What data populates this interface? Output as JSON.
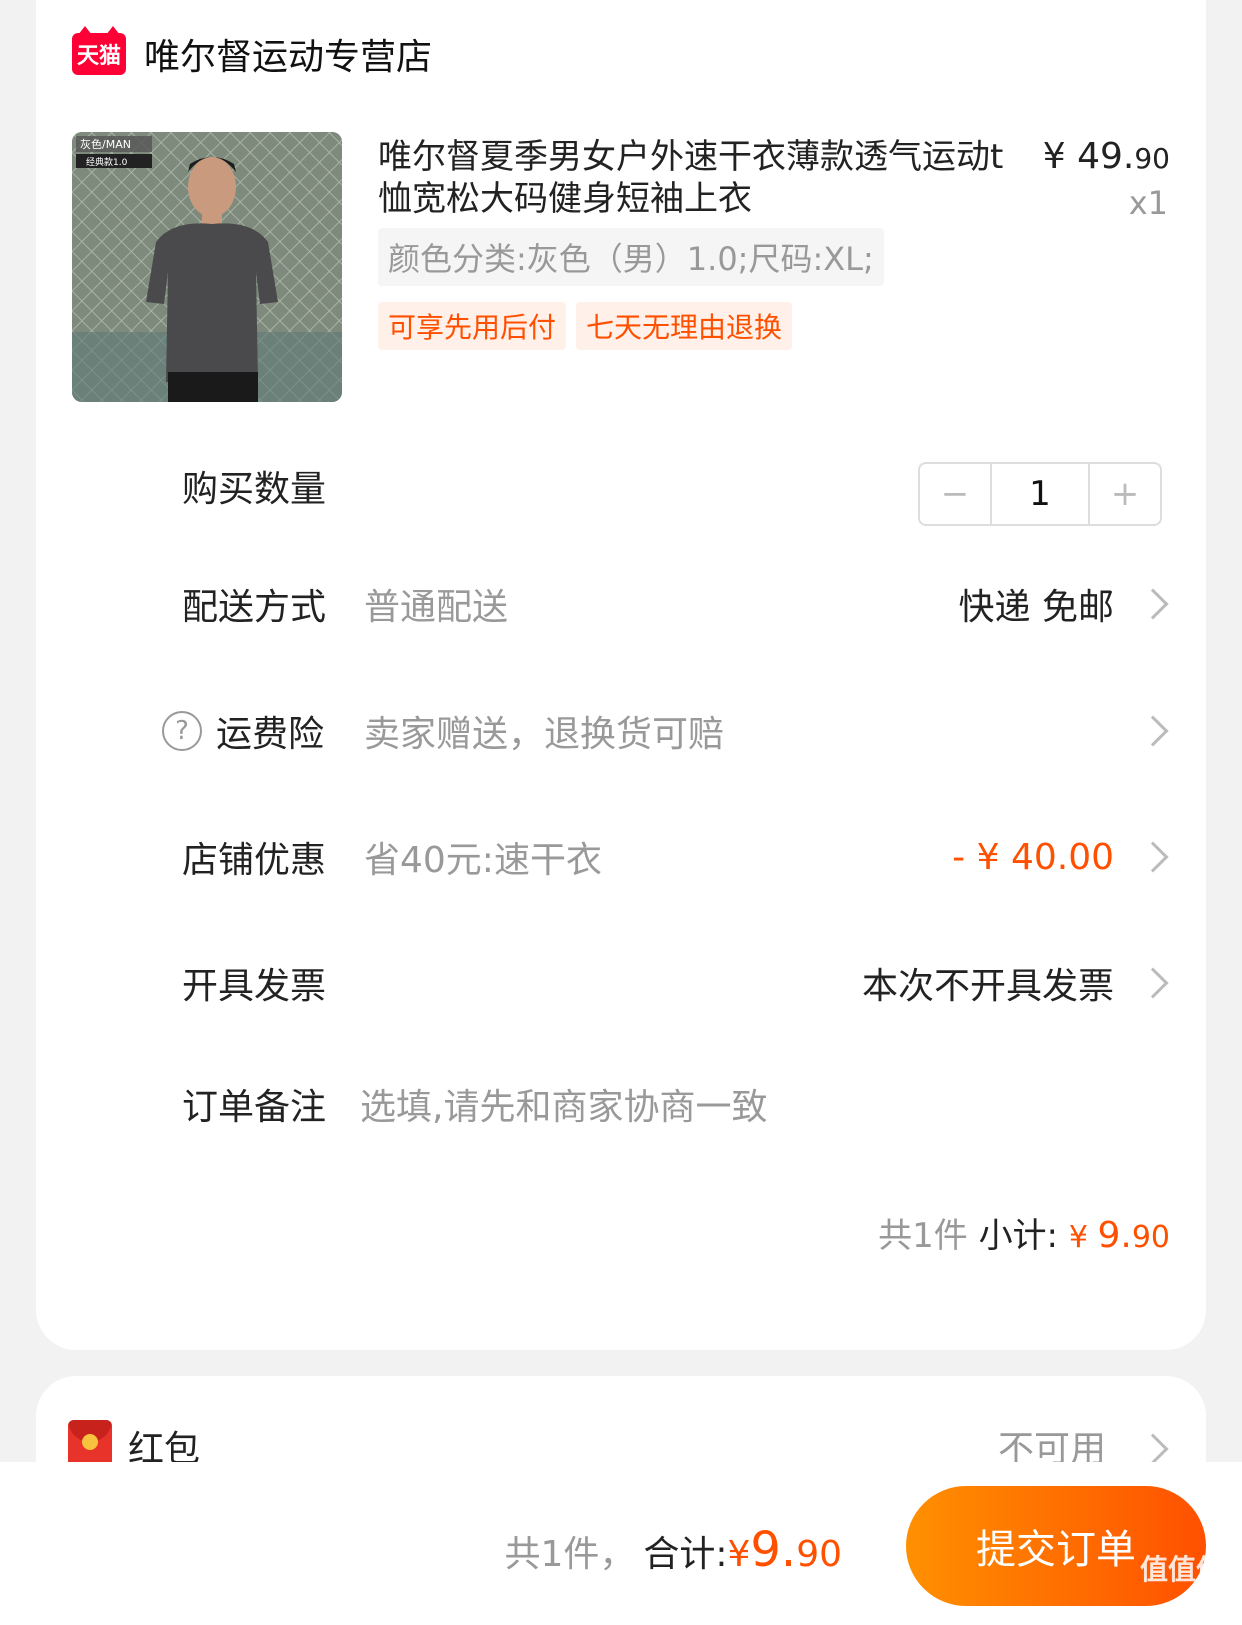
{
  "store": {
    "badge": "天猫",
    "name": "唯尔督运动专营店"
  },
  "product": {
    "image_caption_top": "灰色/MAN",
    "image_caption_bottom": "经典款1.0",
    "title": "唯尔督夏季男女户外速干衣薄款透气运动t恤宽松大码健身短袖上衣",
    "price_main": "¥ 49.",
    "price_cents": "90",
    "quantity": "x1",
    "sku": "颜色分类:灰色（男）1.0;尺码:XL;",
    "tags": [
      "可享先用后付",
      "七天无理由退换"
    ]
  },
  "rows": {
    "quantity_label": "购买数量",
    "quantity_minus": "−",
    "quantity_value": "1",
    "quantity_plus": "+",
    "delivery_label": "配送方式",
    "delivery_sub": "普通配送",
    "delivery_value": "快递 免邮",
    "insurance_icon": "?",
    "insurance_label": "运费险",
    "insurance_sub": "卖家赠送，退换货可赔",
    "discount_label": "店铺优惠",
    "discount_sub": "省40元:速干衣",
    "discount_value": "- ¥ 40.00",
    "invoice_label": "开具发票",
    "invoice_value": "本次不开具发票",
    "note_label": "订单备注",
    "note_placeholder": "选填,请先和商家协商一致"
  },
  "subtotal": {
    "count": "共1件 ",
    "label": "小计: ",
    "currency": "¥ ",
    "amount_main": "9.",
    "amount_cents": "90"
  },
  "red_packet": {
    "label": "红包",
    "value": "不可用"
  },
  "footer": {
    "count": "共1件，",
    "label": "合计:",
    "currency": " ¥ ",
    "amount_main": "9.",
    "amount_cents": "90",
    "submit": "提交订单"
  },
  "watermark": "值值值"
}
